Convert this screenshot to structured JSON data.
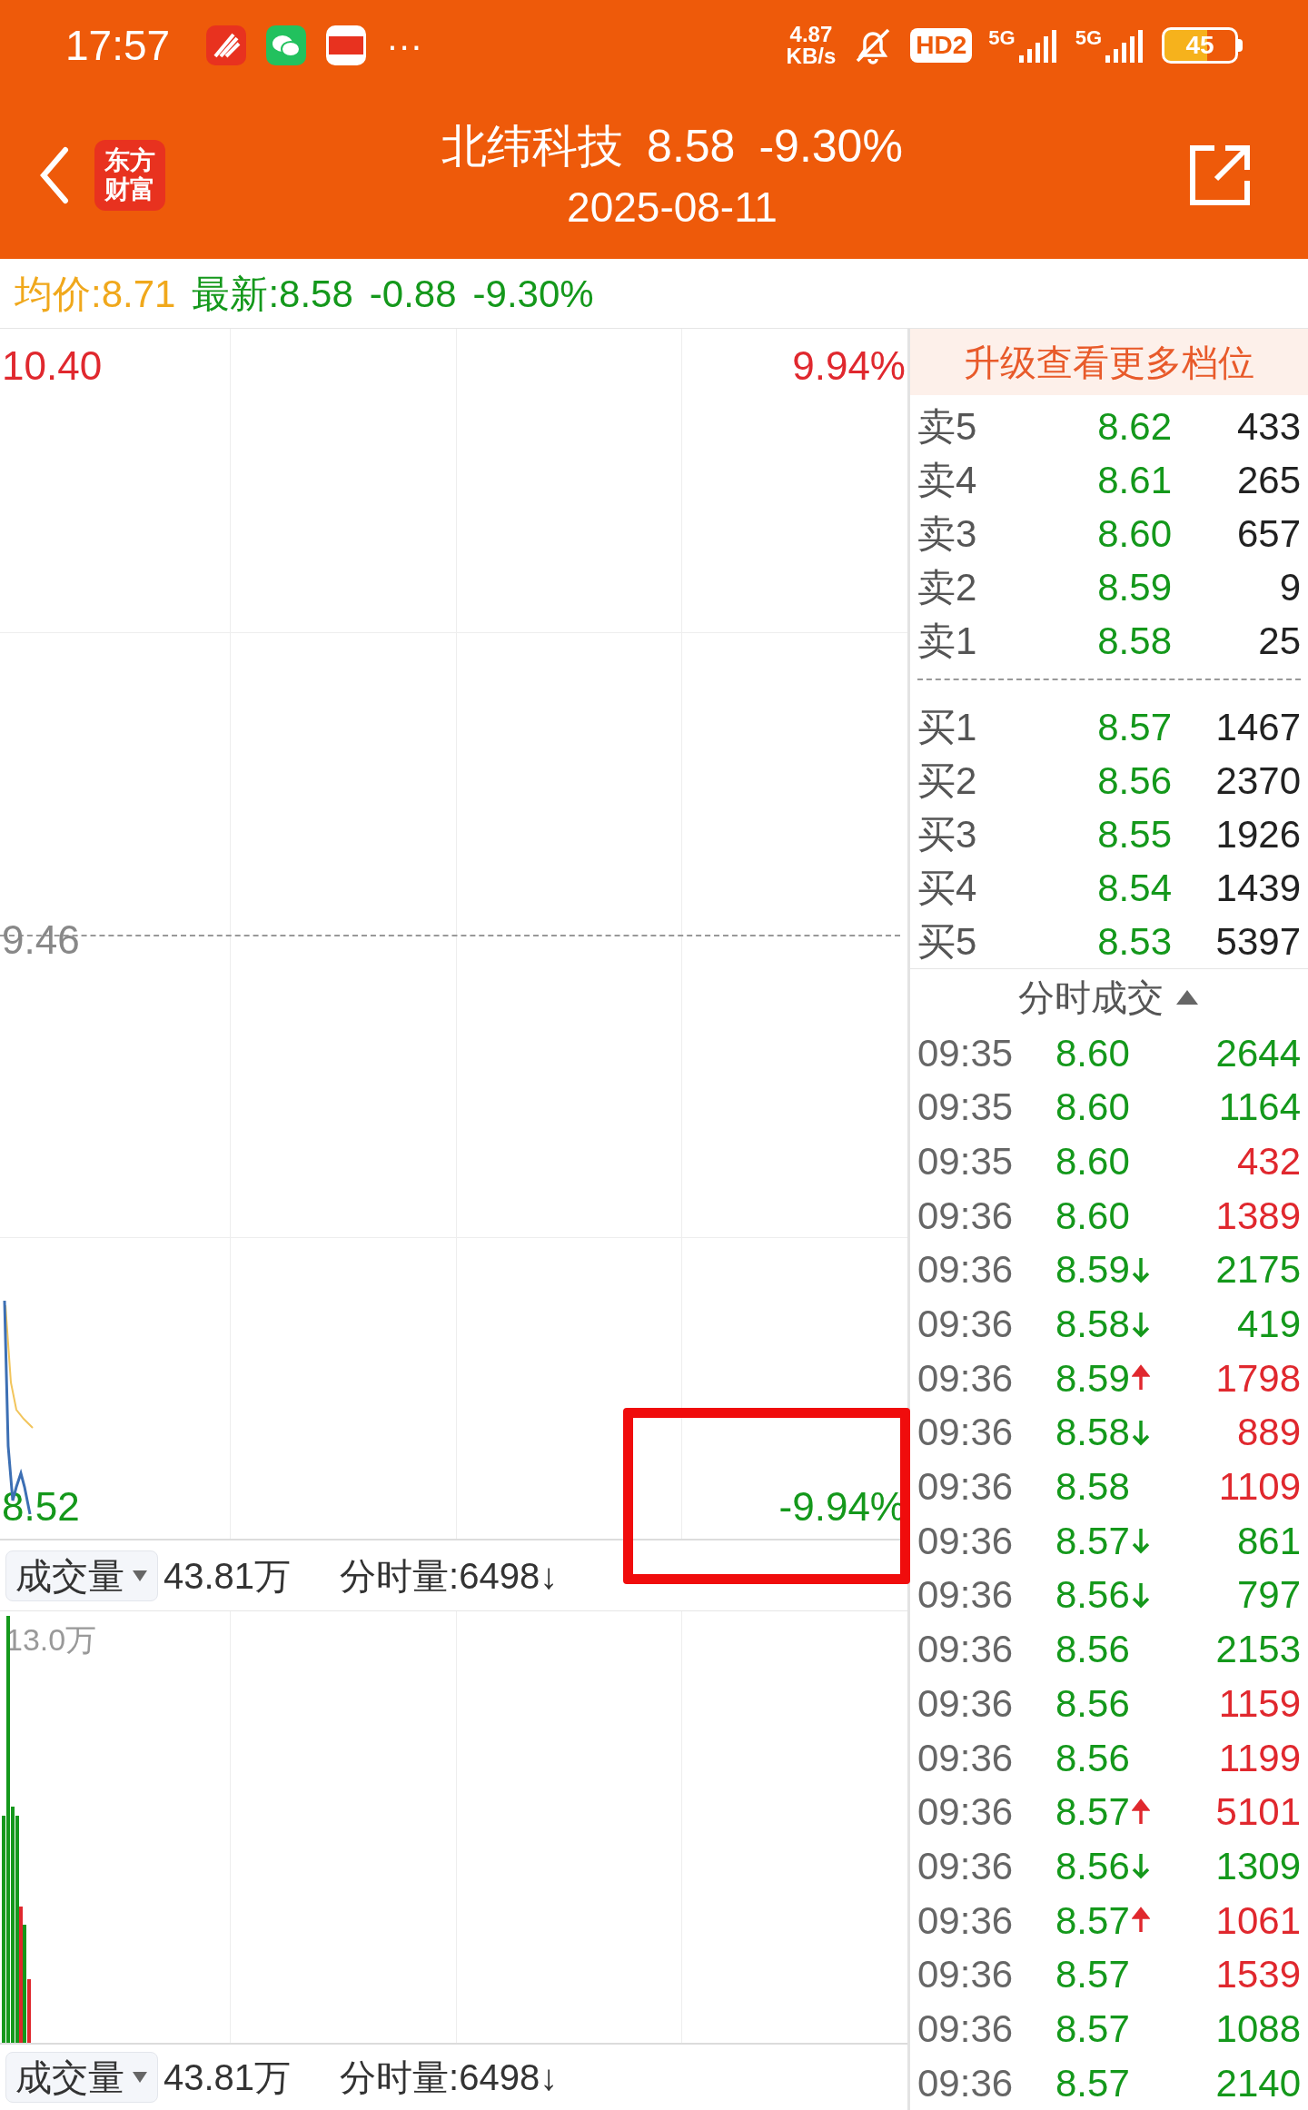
{
  "status_bar": {
    "time": "17:57",
    "more": "···",
    "net_speed": [
      "4.87",
      "KB/s"
    ],
    "hd_badge": "HD2",
    "signals": [
      "5G",
      "5G"
    ],
    "battery": "45"
  },
  "header": {
    "logo": [
      "东方",
      "财富"
    ],
    "name": "北纬科技",
    "price": "8.58",
    "change": "-9.30%",
    "date": "2025-08-11"
  },
  "summary": {
    "avg_label": "均价:",
    "avg": "8.71",
    "latest_label": "最新:",
    "latest": "8.58",
    "change": "-0.88",
    "percent": "-9.30%"
  },
  "chart": {
    "high": "10.40",
    "high_pct": "9.94%",
    "mid": "9.46",
    "low": "8.52",
    "low_pct": "-9.94%"
  },
  "volume_bar": {
    "selector": "成交量",
    "total": "43.81万",
    "tick_volume": "分时量:6498↓"
  },
  "volume_chart": {
    "max": "13.0万"
  },
  "volume_bar_2": {
    "selector": "成交量",
    "total": "43.81万",
    "tick_volume": "分时量:6498↓"
  },
  "order_book": {
    "upgrade": "升级查看更多档位",
    "sell": [
      {
        "label": "卖5",
        "price": "8.62",
        "volume": "433"
      },
      {
        "label": "卖4",
        "price": "8.61",
        "volume": "265"
      },
      {
        "label": "卖3",
        "price": "8.60",
        "volume": "657"
      },
      {
        "label": "卖2",
        "price": "8.59",
        "volume": "9"
      },
      {
        "label": "卖1",
        "price": "8.58",
        "volume": "25"
      }
    ],
    "buy": [
      {
        "label": "买1",
        "price": "8.57",
        "volume": "1467"
      },
      {
        "label": "买2",
        "price": "8.56",
        "volume": "2370"
      },
      {
        "label": "买3",
        "price": "8.55",
        "volume": "1926"
      },
      {
        "label": "买4",
        "price": "8.54",
        "volume": "1439"
      },
      {
        "label": "买5",
        "price": "8.53",
        "volume": "5397"
      }
    ]
  },
  "trades": {
    "title": "分时成交",
    "expanded": true,
    "rows": [
      {
        "time": "09:35",
        "price": "8.60",
        "rising": false,
        "falling": false,
        "volume": "2644",
        "buy": false
      },
      {
        "time": "09:35",
        "price": "8.60",
        "rising": false,
        "falling": false,
        "volume": "1164",
        "buy": false
      },
      {
        "time": "09:35",
        "price": "8.60",
        "rising": false,
        "falling": false,
        "volume": "432",
        "buy": true
      },
      {
        "time": "09:36",
        "price": "8.60",
        "rising": false,
        "falling": false,
        "volume": "1389",
        "buy": true
      },
      {
        "time": "09:36",
        "price": "8.59",
        "rising": false,
        "falling": true,
        "volume": "2175",
        "buy": false
      },
      {
        "time": "09:36",
        "price": "8.58",
        "rising": false,
        "falling": true,
        "volume": "419",
        "buy": false
      },
      {
        "time": "09:36",
        "price": "8.59",
        "rising": true,
        "falling": false,
        "volume": "1798",
        "buy": true
      },
      {
        "time": "09:36",
        "price": "8.58",
        "rising": false,
        "falling": true,
        "volume": "889",
        "buy": true
      },
      {
        "time": "09:36",
        "price": "8.58",
        "rising": false,
        "falling": false,
        "volume": "1109",
        "buy": true
      },
      {
        "time": "09:36",
        "price": "8.57",
        "rising": false,
        "falling": true,
        "volume": "861",
        "buy": false
      },
      {
        "time": "09:36",
        "price": "8.56",
        "rising": false,
        "falling": true,
        "volume": "797",
        "buy": false
      },
      {
        "time": "09:36",
        "price": "8.56",
        "rising": false,
        "falling": false,
        "volume": "2153",
        "buy": false
      },
      {
        "time": "09:36",
        "price": "8.56",
        "rising": false,
        "falling": false,
        "volume": "1159",
        "buy": true
      },
      {
        "time": "09:36",
        "price": "8.56",
        "rising": false,
        "falling": false,
        "volume": "1199",
        "buy": true
      },
      {
        "time": "09:36",
        "price": "8.57",
        "rising": true,
        "falling": false,
        "volume": "5101",
        "buy": true
      },
      {
        "time": "09:36",
        "price": "8.56",
        "rising": false,
        "falling": true,
        "volume": "1309",
        "buy": false
      },
      {
        "time": "09:36",
        "price": "8.57",
        "rising": true,
        "falling": false,
        "volume": "1061",
        "buy": true
      },
      {
        "time": "09:36",
        "price": "8.57",
        "rising": false,
        "falling": false,
        "volume": "1539",
        "buy": true
      },
      {
        "time": "09:36",
        "price": "8.57",
        "rising": false,
        "falling": false,
        "volume": "1088",
        "buy": false
      },
      {
        "time": "09:36",
        "price": "8.57",
        "rising": false,
        "falling": false,
        "volume": "2140",
        "buy": false
      }
    ]
  }
}
